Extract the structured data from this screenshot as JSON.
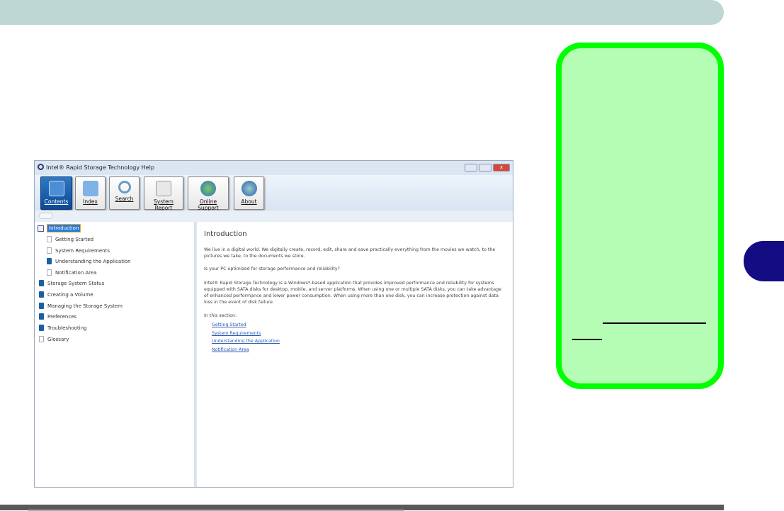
{
  "window": {
    "title": "Intel® Rapid Storage Technology Help",
    "close_label": "x"
  },
  "toolbar": [
    {
      "label": "Contents",
      "icon": "book-icon",
      "active": true
    },
    {
      "label": "Index",
      "icon": "folder-icon"
    },
    {
      "label": "Search",
      "icon": "magnifier-icon"
    },
    {
      "label": "System Report",
      "icon": "report-icon"
    },
    {
      "label": "Online Support",
      "icon": "globe-icon"
    },
    {
      "label": "About",
      "icon": "info-globe-icon"
    }
  ],
  "tree": [
    {
      "label": "Introduction",
      "icon": "open-book",
      "selected": true
    },
    {
      "label": "Getting Started",
      "icon": "page"
    },
    {
      "label": "System Requirements",
      "icon": "page"
    },
    {
      "label": "Understanding the Application",
      "icon": "book"
    },
    {
      "label": "Notification Area",
      "icon": "page"
    },
    {
      "label": "Storage System Status",
      "icon": "book"
    },
    {
      "label": "Creating a Volume",
      "icon": "book"
    },
    {
      "label": "Managing the Storage System",
      "icon": "book"
    },
    {
      "label": "Preferences",
      "icon": "book"
    },
    {
      "label": "Troubleshooting",
      "icon": "book"
    },
    {
      "label": "Glossary",
      "icon": "page"
    }
  ],
  "content": {
    "heading": "Introduction",
    "para1": "We live in a digital world. We digitally create, record, edit, share and save practically everything from the movies we watch, to the pictures we take, to the documents we store.",
    "para2": "Is your PC optimized for storage performance and reliability?",
    "para3": "Intel® Rapid Storage Technology is a Windows*-based application that provides improved performance and reliability for systems equipped with SATA disks for desktop, mobile, and server platforms. When using one or multiple SATA disks, you can take advantage of enhanced performance and lower power consumption. When using more than one disk, you can increase protection against data loss in the event of disk failure.",
    "section_label": "In this section:",
    "links": [
      "Getting Started",
      "System Requirements",
      "Understanding the Application",
      "Notification Area"
    ]
  },
  "colors": {
    "topbar": "#bed6d4",
    "tab": "#140c82",
    "note_border": "#00ff00",
    "note_fill": "#b5fdb5"
  }
}
